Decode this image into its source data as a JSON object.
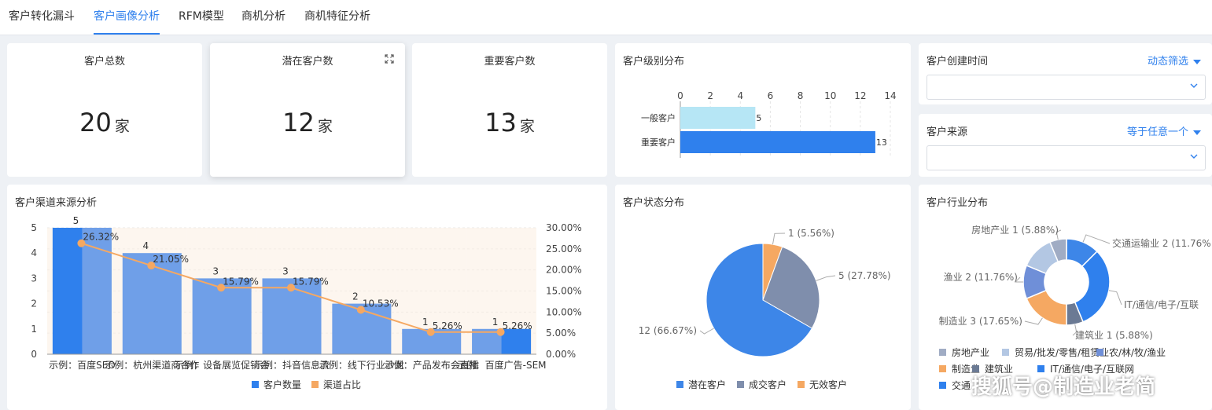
{
  "tabs": [
    {
      "label": "客户转化漏斗",
      "active": false
    },
    {
      "label": "客户画像分析",
      "active": true
    },
    {
      "label": "RFM模型",
      "active": false
    },
    {
      "label": "商机分析",
      "active": false
    },
    {
      "label": "商机特征分析",
      "active": false
    }
  ],
  "kpis": [
    {
      "title": "客户总数",
      "value": "20",
      "unit": "家"
    },
    {
      "title": "潜在客户数",
      "value": "12",
      "unit": "家"
    },
    {
      "title": "重要客户数",
      "value": "13",
      "unit": "家"
    }
  ],
  "filters": [
    {
      "title": "客户创建时间",
      "mode": "动态筛选"
    },
    {
      "title": "客户来源",
      "mode": "等于任意一个"
    }
  ],
  "colors": {
    "blue": "#2f80ed",
    "light_blue": "#b6e6f5",
    "slate": "#7f8eac",
    "orange": "#f5a862",
    "bar_fill": "#6f9fe8"
  },
  "watermark": "搜狐号@制造业老简",
  "chart_data": [
    {
      "id": "level",
      "type": "bar",
      "orientation": "horizontal",
      "title": "客户级别分布",
      "categories": [
        "一般客户",
        "重要客户"
      ],
      "values": [
        5,
        13
      ],
      "xlim": [
        0,
        14
      ],
      "xticks": [
        "0",
        "2",
        "4",
        "6",
        "8",
        "10",
        "12",
        "14"
      ],
      "colors": [
        "#b6e6f5",
        "#2f80ed"
      ],
      "grid": true
    },
    {
      "id": "channel",
      "type": "bar",
      "title": "客户渠道来源分析",
      "categories": [
        "示例：百度SEO",
        "示例：杭州渠道商合作",
        "示例：设备展览促销会",
        "示例：抖音信息流",
        "示例：线下行业沙龙",
        "示例：产品发布会直播",
        "示例：百度广告-SEM"
      ],
      "series": [
        {
          "name": "客户数量",
          "type": "bar",
          "values": [
            5,
            4,
            3,
            3,
            2,
            1,
            1
          ],
          "labels": [
            "5",
            "4",
            "3",
            "3",
            "2",
            "1",
            "1"
          ]
        },
        {
          "name": "渠道占比",
          "type": "line",
          "values": [
            26.32,
            21.05,
            15.79,
            15.79,
            10.53,
            5.26,
            5.26
          ],
          "labels": [
            "26.32%",
            "21.05%",
            "15.79%",
            "15.79%",
            "10.53%",
            "5.26%",
            "5.26%"
          ]
        }
      ],
      "ylim": [
        0,
        5
      ],
      "yticks": [
        "0",
        "1",
        "2",
        "3",
        "4",
        "5"
      ],
      "y2lim": [
        0,
        30
      ],
      "y2ticks": [
        "0.00%",
        "5.00%",
        "10.00%",
        "15.00%",
        "20.00%",
        "25.00%",
        "30.00%"
      ],
      "legend": "bottom",
      "grid": true
    },
    {
      "id": "status",
      "type": "pie",
      "title": "客户状态分布",
      "slices": [
        {
          "name": "潜在客户",
          "value": 12,
          "label": "12 (66.67%)",
          "color": "#3d86e8"
        },
        {
          "name": "成交客户",
          "value": 5,
          "label": "5 (27.78%)",
          "color": "#7f8eac"
        },
        {
          "name": "无效客户",
          "value": 1,
          "label": "1 (5.56%)",
          "color": "#f5a862"
        }
      ],
      "legend": "bottom"
    },
    {
      "id": "industry",
      "type": "pie",
      "donut": true,
      "title": "客户行业分布",
      "slices": [
        {
          "name": "房地产业",
          "value": 1,
          "label": "房地产业 1 (5.88%)",
          "color": "#a0acc4"
        },
        {
          "name": "贸易/批发/零售/租赁业",
          "value": 2,
          "label": "",
          "color": "#b3c7e3"
        },
        {
          "name": "农/林/牧/渔业",
          "value": 2,
          "label": "渔业 2 (11.76%)",
          "color": "#6f8fd8"
        },
        {
          "name": "制造业",
          "value": 3,
          "label": "制造业 3 (17.65%)",
          "color": "#f5a862"
        },
        {
          "name": "建筑业",
          "value": 1,
          "label": "建筑业 1 (5.88%)",
          "color": "#6b7a94"
        },
        {
          "name": "IT/通信/电子/互联网",
          "value": 5,
          "label": "IT/通信/电子/互联",
          "color": "#2f80ed"
        },
        {
          "name": "交通运输业",
          "value": 2,
          "label": "交通运输业 2 (11.76%",
          "color": "#3d86e8"
        }
      ],
      "legend_rows": [
        [
          "房地产业",
          "贸易/批发/零售/租赁业",
          "农/林/牧/渔业"
        ],
        [
          "制造业",
          "建筑业",
          "IT/通信/电子/互联网"
        ],
        [
          "交通"
        ]
      ],
      "legend": "bottom"
    }
  ]
}
